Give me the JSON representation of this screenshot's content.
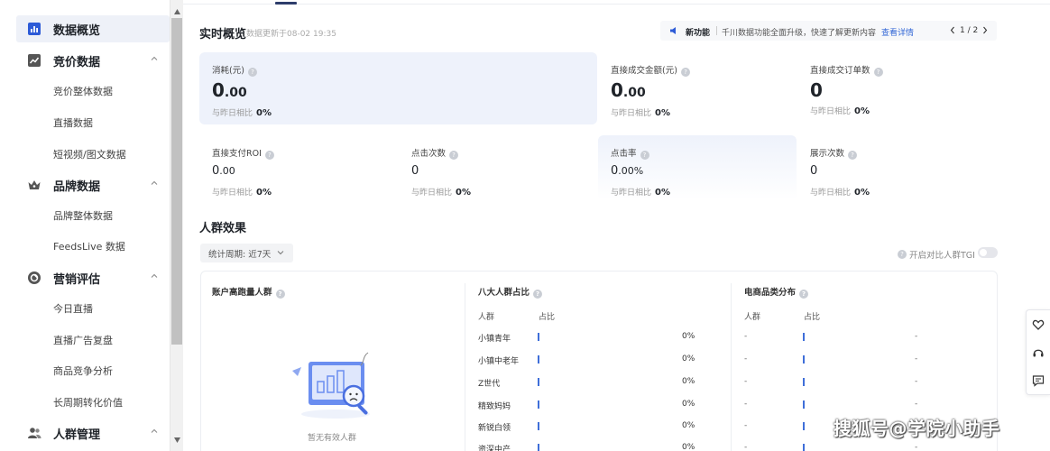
{
  "sidebar": {
    "items": [
      {
        "label": "数据概览",
        "kind": "group",
        "icon": "bar-chart-icon",
        "active": true
      },
      {
        "label": "竞价数据",
        "kind": "group",
        "icon": "line-chart-icon",
        "expandable": true
      },
      {
        "label": "竞价整体数据",
        "kind": "sub"
      },
      {
        "label": "直播数据",
        "kind": "sub"
      },
      {
        "label": "短视频/图文数据",
        "kind": "sub"
      },
      {
        "label": "品牌数据",
        "kind": "group",
        "icon": "crown-icon",
        "expandable": true
      },
      {
        "label": "品牌整体数据",
        "kind": "sub"
      },
      {
        "label": "FeedsLive 数据",
        "kind": "sub"
      },
      {
        "label": "营销评估",
        "kind": "group",
        "icon": "compass-icon",
        "expandable": true
      },
      {
        "label": "今日直播",
        "kind": "sub"
      },
      {
        "label": "直播广告复盘",
        "kind": "sub"
      },
      {
        "label": "商品竞争分析",
        "kind": "sub"
      },
      {
        "label": "长周期转化价值",
        "kind": "sub"
      },
      {
        "label": "人群管理",
        "kind": "group",
        "icon": "users-icon",
        "expandable": true
      }
    ]
  },
  "overview": {
    "title": "实时概览",
    "updated": "数据更新于08-02 19:35"
  },
  "notice": {
    "tag": "新功能",
    "message": "千川数据功能全面升级，快速了解更新内容",
    "link": "查看详情",
    "page": "1 / 2"
  },
  "metrics": [
    {
      "label": "消耗(元)",
      "int": "0",
      "dec": ".00",
      "compare_label": "与昨日相比",
      "compare": "0%"
    },
    {
      "label": "直接成交金额(元)",
      "int": "0",
      "dec": ".00",
      "compare_label": "与昨日相比",
      "compare": "0%"
    },
    {
      "label": "直接成交订单数",
      "int": "0",
      "dec": "",
      "compare_label": "与昨日相比",
      "compare": "0%"
    },
    {
      "label": "直接支付ROI",
      "int": "0",
      "dec": ".00",
      "compare_label": "与昨日相比",
      "compare": "0%"
    },
    {
      "label": "点击次数",
      "int": "0",
      "dec": "",
      "compare_label": "与昨日相比",
      "compare": "0%"
    },
    {
      "label": "点击率",
      "int": "0",
      "dec": ".00%",
      "compare_label": "与昨日相比",
      "compare": "0%"
    },
    {
      "label": "展示次数",
      "int": "0",
      "dec": "",
      "compare_label": "与昨日相比",
      "compare": "0%"
    }
  ],
  "audience": {
    "title": "人群效果",
    "period": "统计周期: 近7天",
    "tgi_label": "开启对比人群TGI",
    "panel1": {
      "title": "账户高跑量人群",
      "empty": "暂无有效人群"
    },
    "panel2": {
      "title": "八大人群占比",
      "col_a": "人群",
      "col_b": "占比",
      "rows": [
        {
          "name": "小镇青年",
          "pct": "0%"
        },
        {
          "name": "小镇中老年",
          "pct": "0%"
        },
        {
          "name": "Z世代",
          "pct": "0%"
        },
        {
          "name": "精致妈妈",
          "pct": "0%"
        },
        {
          "name": "新锐白领",
          "pct": "0%"
        },
        {
          "name": "资深中产",
          "pct": "0%"
        }
      ]
    },
    "panel3": {
      "title": "电商品类分布",
      "col_a": "人群",
      "col_b": "占比",
      "rows": [
        {
          "name": "-",
          "pct": "-"
        },
        {
          "name": "-",
          "pct": "-"
        },
        {
          "name": "-",
          "pct": "-"
        },
        {
          "name": "-",
          "pct": "-"
        },
        {
          "name": "-",
          "pct": "-"
        },
        {
          "name": "-",
          "pct": "-"
        }
      ]
    }
  },
  "watermark": "搜狐号@学院小助手",
  "colors": {
    "accent": "#3367d6",
    "bar": "#3f6fd9",
    "highlight": "#eef2fb"
  }
}
